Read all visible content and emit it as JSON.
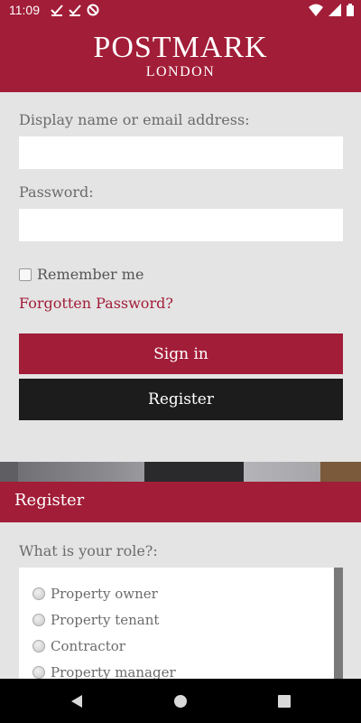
{
  "status_bar": {
    "time": "11:09",
    "icons_left": [
      "checkmark-icon",
      "checkmark-icon",
      "do-not-disturb-icon"
    ],
    "icons_right": [
      "wifi-icon",
      "signal-icon",
      "battery-icon"
    ]
  },
  "header": {
    "brand_name": "POSTMARK",
    "brand_sub": "LONDON"
  },
  "login": {
    "username_label": "Display name or email address:",
    "username_value": "",
    "password_label": "Password:",
    "password_value": "",
    "remember_label": "Remember me",
    "remember_checked": false,
    "forgot_link": "Forgotten Password?",
    "signin_label": "Sign in",
    "register_label": "Register"
  },
  "register_section": {
    "title": "Register",
    "role_question": "What is your role?:",
    "roles": [
      "Property owner",
      "Property tenant",
      "Contractor",
      "Property manager"
    ]
  },
  "colors": {
    "brand": "#a21d38",
    "dark_button": "#1c1c1c",
    "background": "#e4e4e4"
  }
}
